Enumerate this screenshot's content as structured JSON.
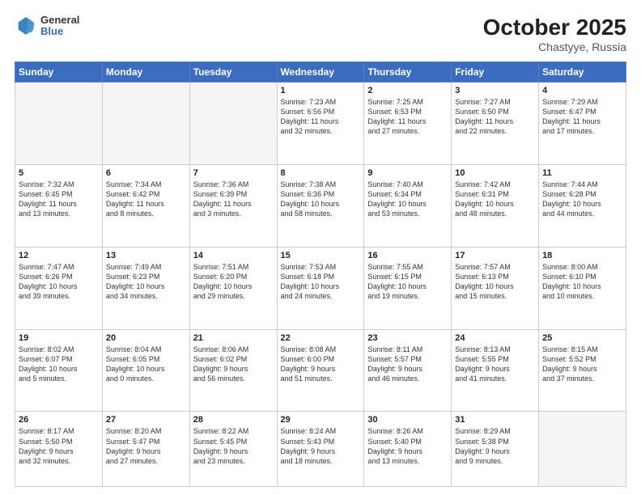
{
  "header": {
    "logo_line1": "General",
    "logo_line2": "Blue",
    "month_year": "October 2025",
    "location": "Chastyye, Russia"
  },
  "days_of_week": [
    "Sunday",
    "Monday",
    "Tuesday",
    "Wednesday",
    "Thursday",
    "Friday",
    "Saturday"
  ],
  "weeks": [
    [
      {
        "day": "",
        "info": ""
      },
      {
        "day": "",
        "info": ""
      },
      {
        "day": "",
        "info": ""
      },
      {
        "day": "1",
        "info": "Sunrise: 7:23 AM\nSunset: 6:56 PM\nDaylight: 11 hours\nand 32 minutes."
      },
      {
        "day": "2",
        "info": "Sunrise: 7:25 AM\nSunset: 6:53 PM\nDaylight: 11 hours\nand 27 minutes."
      },
      {
        "day": "3",
        "info": "Sunrise: 7:27 AM\nSunset: 6:50 PM\nDaylight: 11 hours\nand 22 minutes."
      },
      {
        "day": "4",
        "info": "Sunrise: 7:29 AM\nSunset: 6:47 PM\nDaylight: 11 hours\nand 17 minutes."
      }
    ],
    [
      {
        "day": "5",
        "info": "Sunrise: 7:32 AM\nSunset: 6:45 PM\nDaylight: 11 hours\nand 13 minutes."
      },
      {
        "day": "6",
        "info": "Sunrise: 7:34 AM\nSunset: 6:42 PM\nDaylight: 11 hours\nand 8 minutes."
      },
      {
        "day": "7",
        "info": "Sunrise: 7:36 AM\nSunset: 6:39 PM\nDaylight: 11 hours\nand 3 minutes."
      },
      {
        "day": "8",
        "info": "Sunrise: 7:38 AM\nSunset: 6:36 PM\nDaylight: 10 hours\nand 58 minutes."
      },
      {
        "day": "9",
        "info": "Sunrise: 7:40 AM\nSunset: 6:34 PM\nDaylight: 10 hours\nand 53 minutes."
      },
      {
        "day": "10",
        "info": "Sunrise: 7:42 AM\nSunset: 6:31 PM\nDaylight: 10 hours\nand 48 minutes."
      },
      {
        "day": "11",
        "info": "Sunrise: 7:44 AM\nSunset: 6:28 PM\nDaylight: 10 hours\nand 44 minutes."
      }
    ],
    [
      {
        "day": "12",
        "info": "Sunrise: 7:47 AM\nSunset: 6:26 PM\nDaylight: 10 hours\nand 39 minutes."
      },
      {
        "day": "13",
        "info": "Sunrise: 7:49 AM\nSunset: 6:23 PM\nDaylight: 10 hours\nand 34 minutes."
      },
      {
        "day": "14",
        "info": "Sunrise: 7:51 AM\nSunset: 6:20 PM\nDaylight: 10 hours\nand 29 minutes."
      },
      {
        "day": "15",
        "info": "Sunrise: 7:53 AM\nSunset: 6:18 PM\nDaylight: 10 hours\nand 24 minutes."
      },
      {
        "day": "16",
        "info": "Sunrise: 7:55 AM\nSunset: 6:15 PM\nDaylight: 10 hours\nand 19 minutes."
      },
      {
        "day": "17",
        "info": "Sunrise: 7:57 AM\nSunset: 6:13 PM\nDaylight: 10 hours\nand 15 minutes."
      },
      {
        "day": "18",
        "info": "Sunrise: 8:00 AM\nSunset: 6:10 PM\nDaylight: 10 hours\nand 10 minutes."
      }
    ],
    [
      {
        "day": "19",
        "info": "Sunrise: 8:02 AM\nSunset: 6:07 PM\nDaylight: 10 hours\nand 5 minutes."
      },
      {
        "day": "20",
        "info": "Sunrise: 8:04 AM\nSunset: 6:05 PM\nDaylight: 10 hours\nand 0 minutes."
      },
      {
        "day": "21",
        "info": "Sunrise: 8:06 AM\nSunset: 6:02 PM\nDaylight: 9 hours\nand 56 minutes."
      },
      {
        "day": "22",
        "info": "Sunrise: 8:08 AM\nSunset: 6:00 PM\nDaylight: 9 hours\nand 51 minutes."
      },
      {
        "day": "23",
        "info": "Sunrise: 8:11 AM\nSunset: 5:57 PM\nDaylight: 9 hours\nand 46 minutes."
      },
      {
        "day": "24",
        "info": "Sunrise: 8:13 AM\nSunset: 5:55 PM\nDaylight: 9 hours\nand 41 minutes."
      },
      {
        "day": "25",
        "info": "Sunrise: 8:15 AM\nSunset: 5:52 PM\nDaylight: 9 hours\nand 37 minutes."
      }
    ],
    [
      {
        "day": "26",
        "info": "Sunrise: 8:17 AM\nSunset: 5:50 PM\nDaylight: 9 hours\nand 32 minutes."
      },
      {
        "day": "27",
        "info": "Sunrise: 8:20 AM\nSunset: 5:47 PM\nDaylight: 9 hours\nand 27 minutes."
      },
      {
        "day": "28",
        "info": "Sunrise: 8:22 AM\nSunset: 5:45 PM\nDaylight: 9 hours\nand 23 minutes."
      },
      {
        "day": "29",
        "info": "Sunrise: 8:24 AM\nSunset: 5:43 PM\nDaylight: 9 hours\nand 18 minutes."
      },
      {
        "day": "30",
        "info": "Sunrise: 8:26 AM\nSunset: 5:40 PM\nDaylight: 9 hours\nand 13 minutes."
      },
      {
        "day": "31",
        "info": "Sunrise: 8:29 AM\nSunset: 5:38 PM\nDaylight: 9 hours\nand 9 minutes."
      },
      {
        "day": "",
        "info": ""
      }
    ]
  ]
}
